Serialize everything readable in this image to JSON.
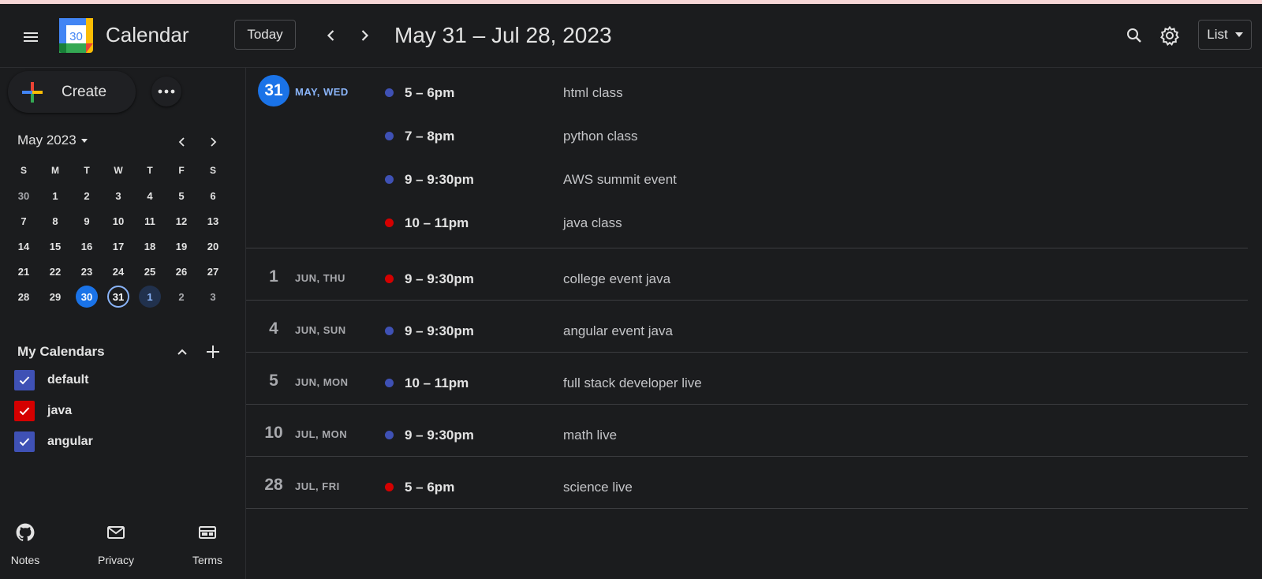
{
  "header": {
    "app_title": "Calendar",
    "logo_day": "30",
    "today_label": "Today",
    "range_title": "May 31 – Jul 28, 2023",
    "view_label": "List",
    "icons": [
      "menu-icon",
      "prev-chevron-icon",
      "next-chevron-icon",
      "search-icon",
      "gear-icon",
      "caret-down-icon"
    ]
  },
  "sidebar": {
    "create_label": "Create",
    "mini_calendar": {
      "month_label": "May 2023",
      "weekdays": [
        "S",
        "M",
        "T",
        "W",
        "T",
        "F",
        "S"
      ],
      "weeks": [
        [
          "30",
          "1",
          "2",
          "3",
          "4",
          "5",
          "6"
        ],
        [
          "7",
          "8",
          "9",
          "10",
          "11",
          "12",
          "13"
        ],
        [
          "14",
          "15",
          "16",
          "17",
          "18",
          "19",
          "20"
        ],
        [
          "21",
          "22",
          "23",
          "24",
          "25",
          "26",
          "27"
        ],
        [
          "28",
          "29",
          "30",
          "31",
          "1",
          "2",
          "3"
        ]
      ],
      "selected_day": "30",
      "today_day": "31"
    },
    "my_calendars": {
      "title": "My Calendars",
      "items": [
        {
          "label": "default",
          "color": "#3f51b5"
        },
        {
          "label": "java",
          "color": "#d50000"
        },
        {
          "label": "angular",
          "color": "#3f51b5"
        }
      ]
    },
    "footer": [
      {
        "label": "Notes",
        "icon": "github-icon"
      },
      {
        "label": "Privacy",
        "icon": "mail-icon"
      },
      {
        "label": "Terms",
        "icon": "web-icon"
      }
    ]
  },
  "colors": {
    "accent": "#1a73e8",
    "accent_light": "#8ab4f8",
    "calendar_blue": "#3f51b5",
    "calendar_red": "#d50000",
    "background": "#1b1c1e"
  },
  "agenda": [
    {
      "day": "31",
      "label": "MAY, WED",
      "today": true,
      "events": [
        {
          "time": "5 – 6pm",
          "title": "html class",
          "color": "#3f51b5"
        },
        {
          "time": "7 – 8pm",
          "title": "python class",
          "color": "#3f51b5"
        },
        {
          "time": "9 – 9:30pm",
          "title": "AWS summit event",
          "color": "#3f51b5"
        },
        {
          "time": "10 – 11pm",
          "title": "java class",
          "color": "#d50000"
        }
      ]
    },
    {
      "day": "1",
      "label": "JUN, THU",
      "today": false,
      "events": [
        {
          "time": "9 – 9:30pm",
          "title": "college event java",
          "color": "#d50000"
        }
      ]
    },
    {
      "day": "4",
      "label": "JUN, SUN",
      "today": false,
      "events": [
        {
          "time": "9 – 9:30pm",
          "title": "angular event java",
          "color": "#3f51b5"
        }
      ]
    },
    {
      "day": "5",
      "label": "JUN, MON",
      "today": false,
      "events": [
        {
          "time": "10 – 11pm",
          "title": "full stack developer live",
          "color": "#3f51b5"
        }
      ]
    },
    {
      "day": "10",
      "label": "JUL, MON",
      "today": false,
      "events": [
        {
          "time": "9 – 9:30pm",
          "title": "math live",
          "color": "#3f51b5"
        }
      ]
    },
    {
      "day": "28",
      "label": "JUL, FRI",
      "today": false,
      "events": [
        {
          "time": "5 – 6pm",
          "title": "science live",
          "color": "#d50000"
        }
      ]
    }
  ]
}
